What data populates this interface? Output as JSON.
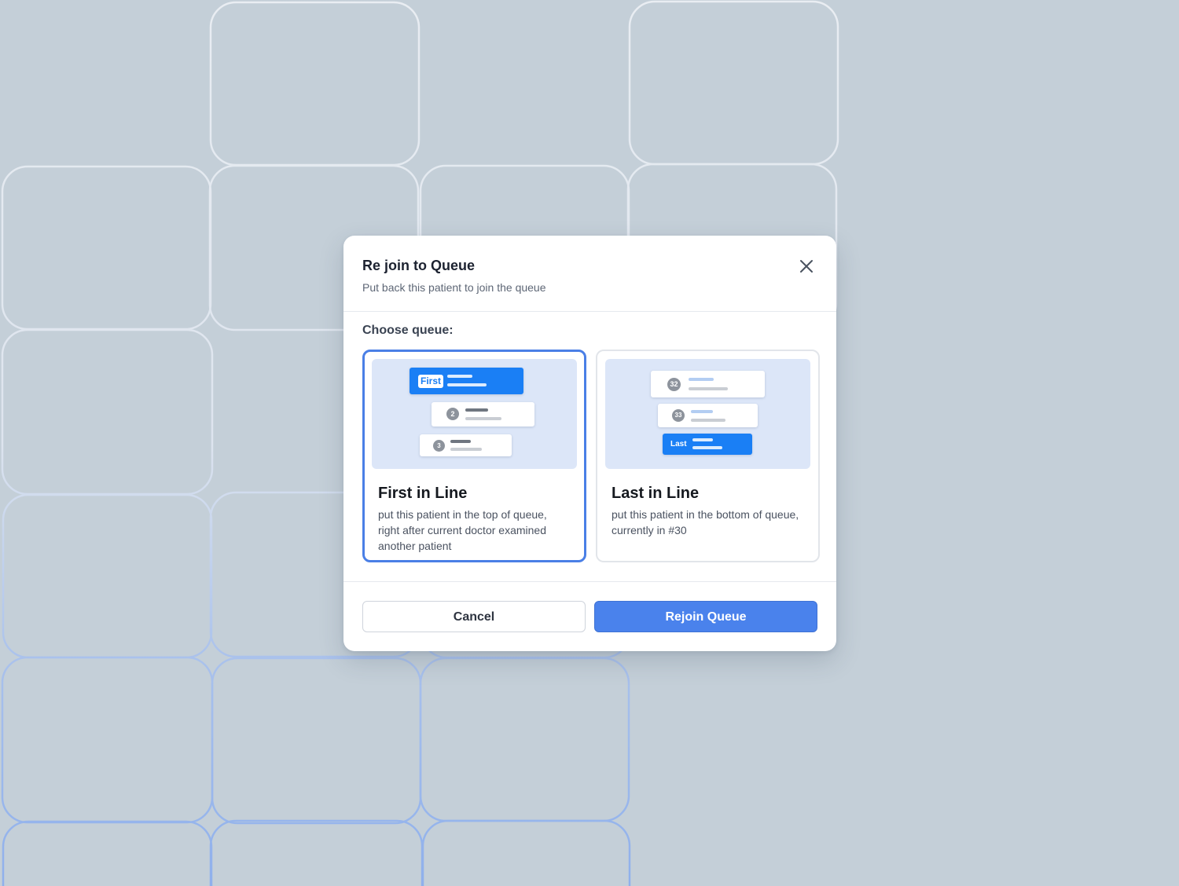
{
  "dialog": {
    "title": "Re join to Queue",
    "subtitle": "Put back this patient to join the queue",
    "close_icon": "close-icon"
  },
  "choose_label": "Choose queue:",
  "options": [
    {
      "id": "first",
      "selected": true,
      "title": "First in Line",
      "description": "put this patient in the top of queue, right after current doctor examined another patient",
      "illustration": {
        "highlight_tag": "First",
        "numbers": [
          "2",
          "3"
        ]
      }
    },
    {
      "id": "last",
      "selected": false,
      "title": "Last in Line",
      "description": "put this patient in the bottom of queue, currently in #30",
      "illustration": {
        "highlight_tag": "Last",
        "numbers": [
          "32",
          "33"
        ]
      }
    }
  ],
  "footer": {
    "cancel_label": "Cancel",
    "primary_label": "Rejoin Queue"
  },
  "colors": {
    "background": "#c4cfd8",
    "accent": "#4a82ec",
    "selected_border": "#4a7fe6",
    "highlight_card": "#1a7ff5",
    "illustration_bg": "#dce6f8"
  }
}
